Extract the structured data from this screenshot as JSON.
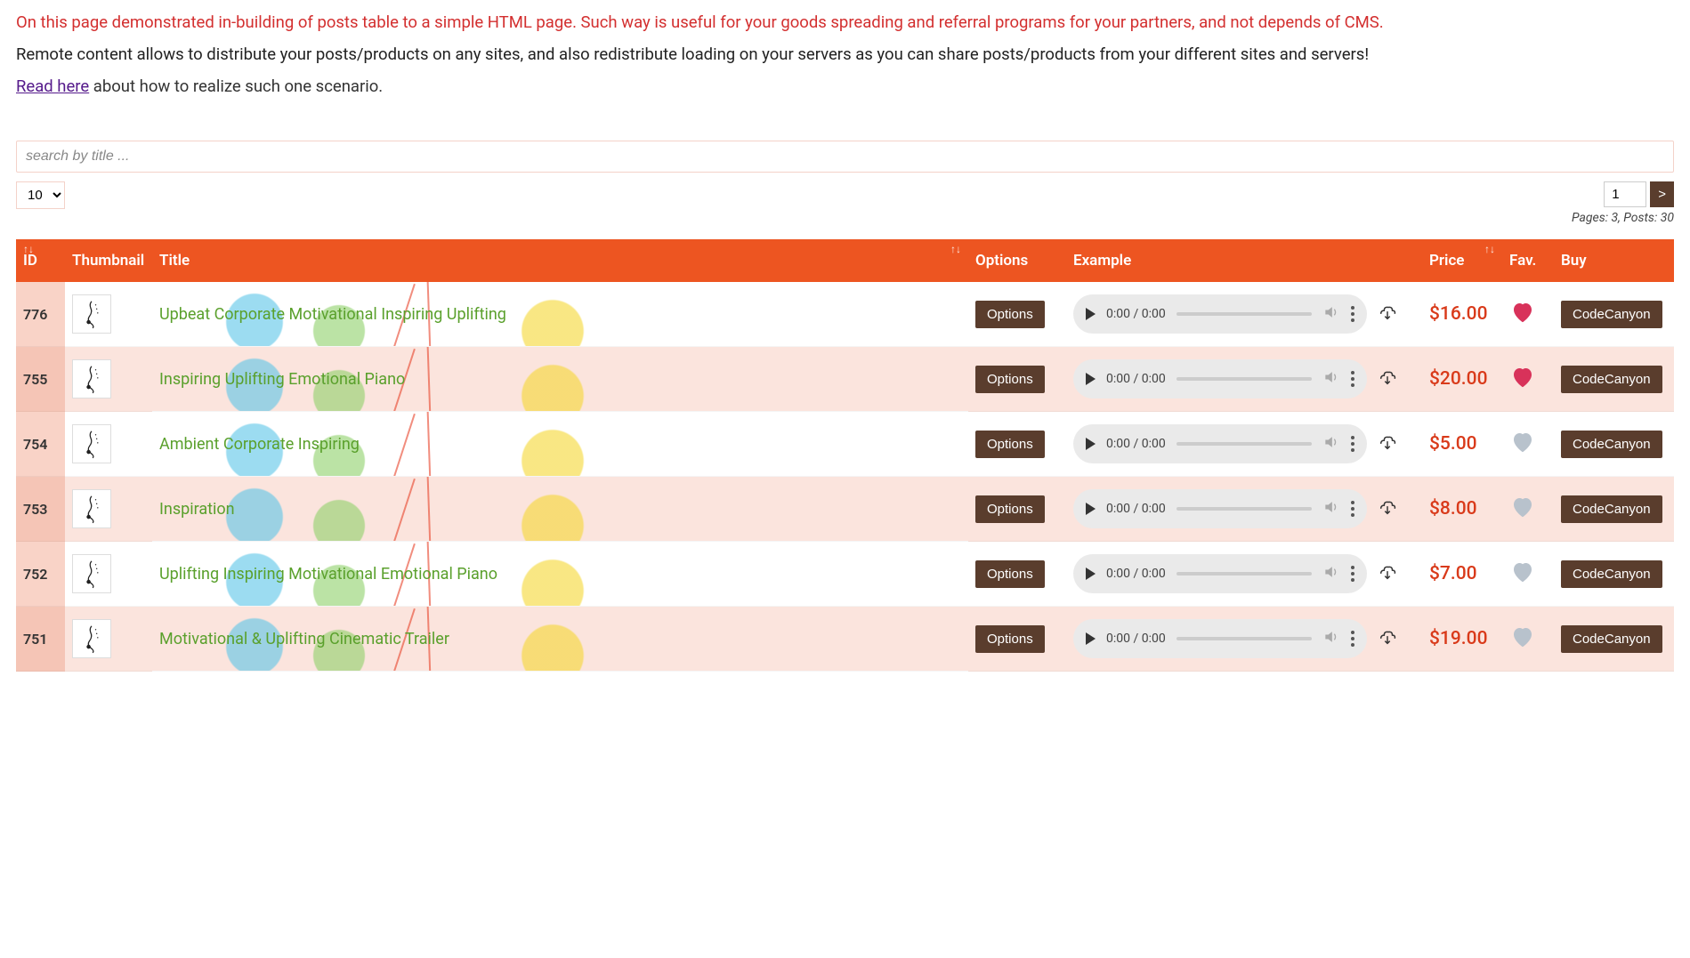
{
  "intro": {
    "line1": "On this page demonstrated in-building of posts table to a simple HTML page. Such way is useful for your goods spreading and referral programs for your partners, and not depends of CMS.",
    "line2": "Remote content allows to distribute your posts/products on any sites, and also redistribute loading on your servers as you can share posts/products from your different sites and servers!",
    "link_text": "Read here",
    "link_after": " about how to realize such one scenario."
  },
  "search": {
    "placeholder": "search by title ..."
  },
  "perpage": {
    "selected": "10",
    "options": [
      "10"
    ]
  },
  "pager": {
    "current": "1",
    "next_label": ">",
    "info": "Pages: 3, Posts: 30"
  },
  "columns": {
    "id": "ID",
    "thumbnail": "Thumbnail",
    "title": "Title",
    "options": "Options",
    "example": "Example",
    "price": "Price",
    "fav": "Fav.",
    "buy": "Buy"
  },
  "buttons": {
    "options": "Options",
    "buy": "CodeCanyon"
  },
  "audio": {
    "time": "0:00 / 0:00"
  },
  "rows": [
    {
      "id": "776",
      "title": "Upbeat Corporate Motivational Inspiring Uplifting",
      "price": "$16.00",
      "fav": true
    },
    {
      "id": "755",
      "title": "Inspiring Uplifting Emotional Piano",
      "price": "$20.00",
      "fav": true
    },
    {
      "id": "754",
      "title": "Ambient Corporate Inspiring",
      "price": "$5.00",
      "fav": false
    },
    {
      "id": "753",
      "title": "Inspiration",
      "price": "$8.00",
      "fav": false
    },
    {
      "id": "752",
      "title": "Uplifting Inspiring Motivational Emotional Piano",
      "price": "$7.00",
      "fav": false
    },
    {
      "id": "751",
      "title": "Motivational & Uplifting Cinematic Trailer",
      "price": "$19.00",
      "fav": false
    }
  ]
}
